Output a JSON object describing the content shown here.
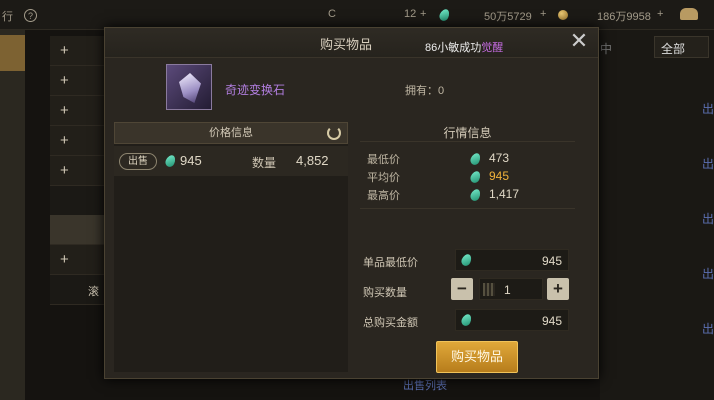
{
  "topbar": {
    "left_text": "行",
    "help_glyph": "?",
    "badge_text": "C",
    "gem_count": "12",
    "gem_amount": "50万5729",
    "coin_amount": "186万9958",
    "plus": "+"
  },
  "background": {
    "plus": "+",
    "list_partial": "滚",
    "tab_partial": "中",
    "tab_all": "全部",
    "right_link": "出",
    "bottom_link": "出售列表"
  },
  "modal": {
    "title": "购买物品",
    "toast_prefix": "86小敏成功",
    "toast_highlight": "觉醒",
    "close": "✕",
    "item_name": "奇迹变换石",
    "owned": "拥有：0"
  },
  "price_panel": {
    "header": "价格信息",
    "sell_tag": "出售",
    "price": "945",
    "qty_label": "数量",
    "qty": "4,852"
  },
  "market": {
    "header": "行情信息",
    "rows": [
      {
        "label": "最低价",
        "value": "473"
      },
      {
        "label": "平均价",
        "value": "945"
      },
      {
        "label": "最高价",
        "value": "1,417"
      }
    ]
  },
  "form": {
    "unit_price_label": "单品最低价",
    "unit_price": "945",
    "qty_label": "购买数量",
    "minus": "−",
    "plus": "+",
    "qty": "1",
    "total_label": "总购买金额",
    "total": "945",
    "buy_button": "购买物品"
  },
  "colors": {
    "accent_orange": "#d69a2e",
    "item_purple": "#b27ee0",
    "gem_teal": "#4fd6ac",
    "highlight_gold": "#f0b23a"
  }
}
